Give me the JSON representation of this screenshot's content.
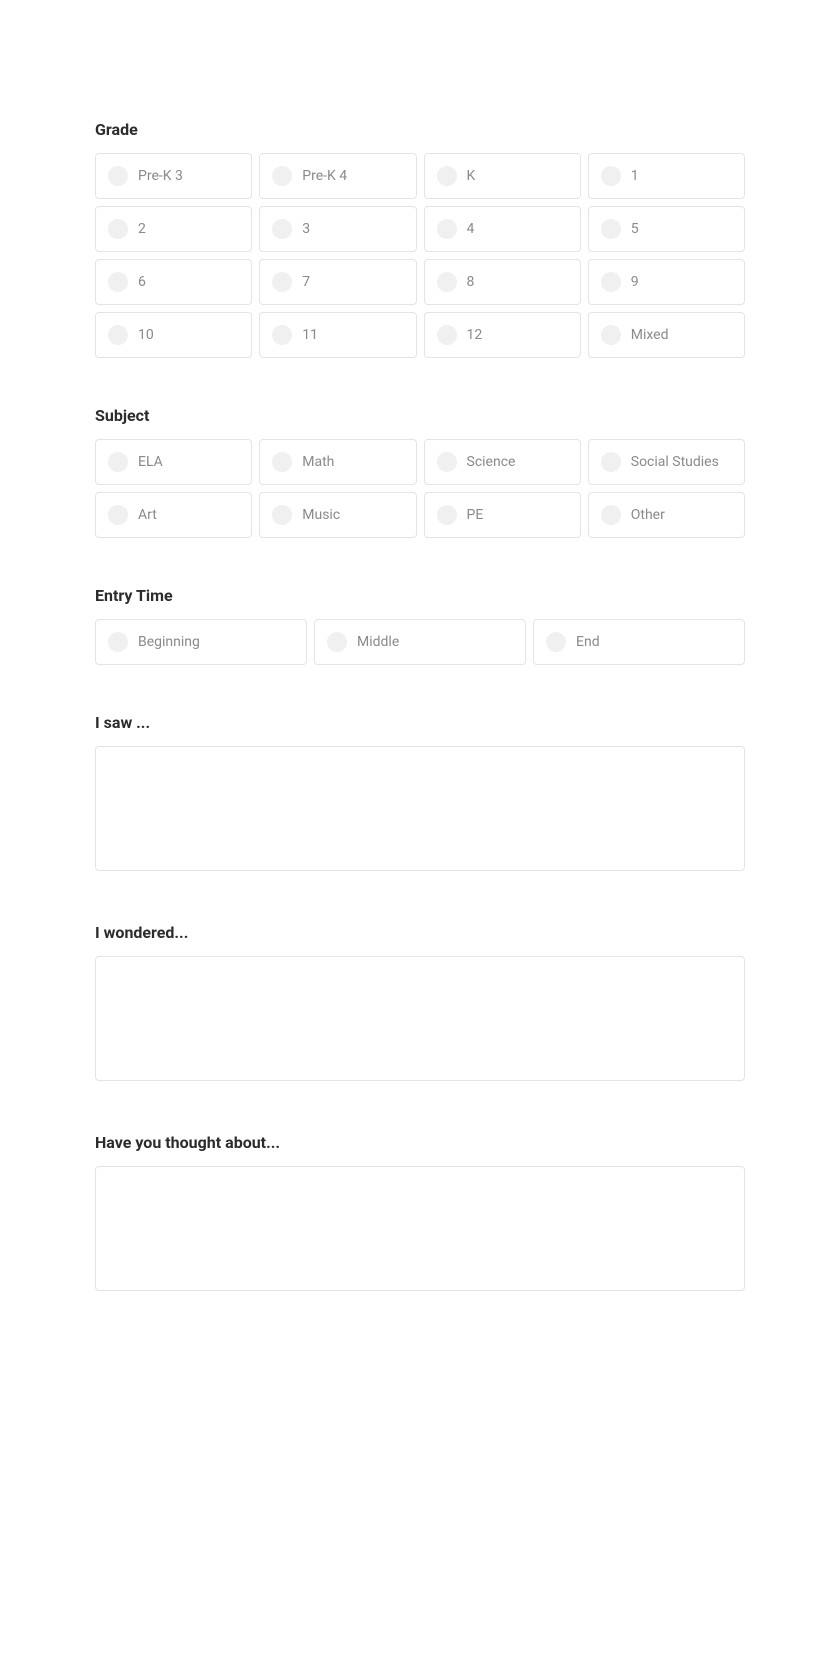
{
  "grade": {
    "title": "Grade",
    "options": [
      "Pre-K 3",
      "Pre-K 4",
      "K",
      "1",
      "2",
      "3",
      "4",
      "5",
      "6",
      "7",
      "8",
      "9",
      "10",
      "11",
      "12",
      "Mixed"
    ]
  },
  "subject": {
    "title": "Subject",
    "options": [
      "ELA",
      "Math",
      "Science",
      "Social Studies",
      "Art",
      "Music",
      "PE",
      "Other"
    ]
  },
  "entryTime": {
    "title": "Entry Time",
    "options": [
      "Beginning",
      "Middle",
      "End"
    ]
  },
  "textareas": [
    {
      "title": "I saw ...",
      "value": ""
    },
    {
      "title": "I wondered...",
      "value": ""
    },
    {
      "title": "Have you thought about...",
      "value": ""
    }
  ]
}
